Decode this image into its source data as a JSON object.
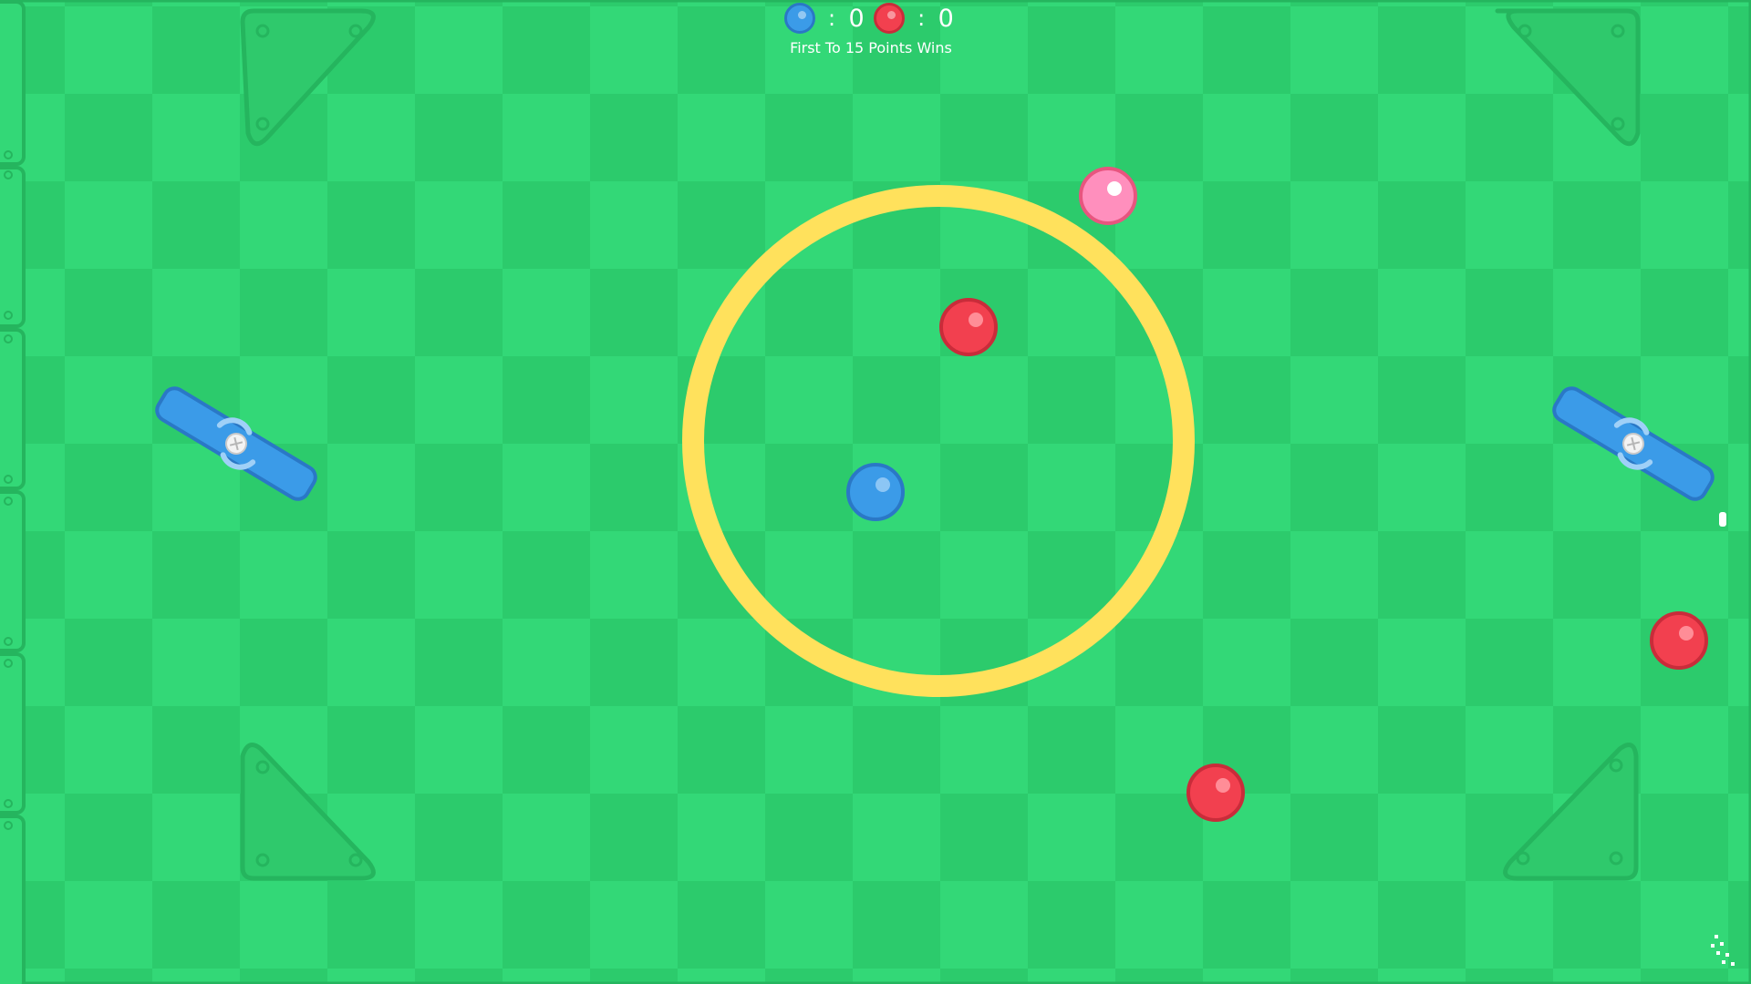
{
  "hud": {
    "blue_colon": ":",
    "blue_score": "0",
    "red_colon": ":",
    "red_score": "0",
    "win_rule": "First To 15 Points Wins"
  },
  "colors": {
    "field_light": "#33d877",
    "field_dark": "#2ccb6c",
    "border": "#25b55e",
    "ring": "#ffe15c",
    "blue_team": "#3b9be8",
    "red_team": "#f2404f",
    "ball": "#ff8fbd"
  }
}
